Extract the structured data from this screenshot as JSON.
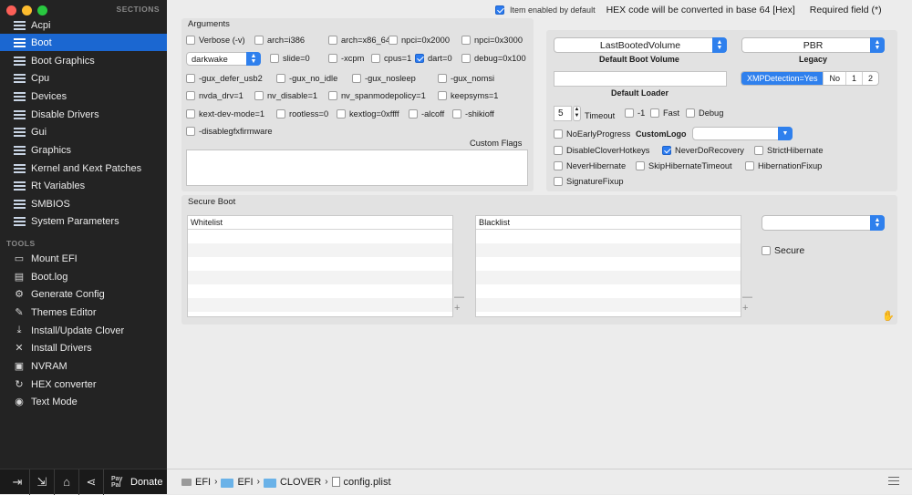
{
  "sidebar": {
    "sections_header": "SECTIONS",
    "items": [
      {
        "label": "Acpi",
        "icon": "list-icon"
      },
      {
        "label": "Boot",
        "icon": "list-icon"
      },
      {
        "label": "Boot Graphics",
        "icon": "list-icon"
      },
      {
        "label": "Cpu",
        "icon": "list-icon"
      },
      {
        "label": "Devices",
        "icon": "list-icon"
      },
      {
        "label": "Disable Drivers",
        "icon": "list-icon"
      },
      {
        "label": "Gui",
        "icon": "list-icon"
      },
      {
        "label": "Graphics",
        "icon": "list-icon"
      },
      {
        "label": "Kernel and Kext Patches",
        "icon": "list-icon"
      },
      {
        "label": "Rt Variables",
        "icon": "list-icon"
      },
      {
        "label": "SMBIOS",
        "icon": "list-icon"
      },
      {
        "label": "System Parameters",
        "icon": "list-icon"
      }
    ],
    "selected": "Boot",
    "tools_header": "TOOLS",
    "tools": [
      {
        "label": "Mount EFI",
        "icon": "drive-icon"
      },
      {
        "label": "Boot.log",
        "icon": "document-icon"
      },
      {
        "label": "Generate Config",
        "icon": "gear-icon"
      },
      {
        "label": "Themes Editor",
        "icon": "paint-icon"
      },
      {
        "label": "Install/Update Clover",
        "icon": "download-icon"
      },
      {
        "label": "Install Drivers",
        "icon": "wrench-icon"
      },
      {
        "label": "NVRAM",
        "icon": "chip-icon"
      },
      {
        "label": "HEX converter",
        "icon": "refresh-icon"
      },
      {
        "label": "Text Mode",
        "icon": "eye-icon"
      }
    ],
    "donate_label": "Donate",
    "paypal_text": "Pay Pal"
  },
  "topbar": {
    "enabled_default": "Item enabled by default",
    "hex_note": "HEX code will be converted in base 64 [Hex]",
    "required": "Required field (*)"
  },
  "arguments": {
    "title": "Arguments",
    "row1": [
      {
        "label": "Verbose (-v)",
        "checked": false
      },
      {
        "label": "arch=i386",
        "checked": false
      },
      {
        "label": "arch=x86_64",
        "checked": false
      },
      {
        "label": "npci=0x2000",
        "checked": false
      },
      {
        "label": "npci=0x3000",
        "checked": false
      }
    ],
    "darkwake_value": "darkwake",
    "row2": [
      {
        "label": "slide=0",
        "checked": false
      },
      {
        "label": "-xcpm",
        "checked": false
      },
      {
        "label": "cpus=1",
        "checked": false
      },
      {
        "label": "dart=0",
        "checked": true
      },
      {
        "label": "debug=0x100",
        "checked": false
      }
    ],
    "row3": [
      {
        "label": "-gux_defer_usb2",
        "checked": false
      },
      {
        "label": "-gux_no_idle",
        "checked": false
      },
      {
        "label": "-gux_nosleep",
        "checked": false
      },
      {
        "label": "-gux_nomsi",
        "checked": false
      }
    ],
    "row4": [
      {
        "label": "nvda_drv=1",
        "checked": false
      },
      {
        "label": "nv_disable=1",
        "checked": false
      },
      {
        "label": "nv_spanmodepolicy=1",
        "checked": false
      },
      {
        "label": "keepsyms=1",
        "checked": false
      }
    ],
    "row5": [
      {
        "label": "kext-dev-mode=1",
        "checked": false
      },
      {
        "label": "rootless=0",
        "checked": false
      },
      {
        "label": "kextlog=0xffff",
        "checked": false
      },
      {
        "label": "-alcoff",
        "checked": false
      },
      {
        "label": "-shikioff",
        "checked": false
      }
    ],
    "row6": [
      {
        "label": "-disablegfxfirmware",
        "checked": false
      }
    ],
    "custom_flags_label": "Custom Flags",
    "custom_flags_value": ""
  },
  "boot_options": {
    "default_volume_value": "LastBootedVolume",
    "default_volume_label": "Default Boot Volume",
    "legacy_value": "PBR",
    "legacy_label": "Legacy",
    "default_loader_label": "Default Loader",
    "default_loader_value": "",
    "xmp_segments": [
      "XMPDetection=Yes",
      "No",
      "1",
      "2"
    ],
    "xmp_selected": "XMPDetection=Yes",
    "timeout_value": "5",
    "timeout_label": "Timeout",
    "timeout_checks": [
      {
        "label": "-1",
        "checked": false
      },
      {
        "label": "Fast",
        "checked": false
      },
      {
        "label": "Debug",
        "checked": false
      }
    ],
    "no_early_progress": {
      "label": "NoEarlyProgress",
      "checked": false
    },
    "custom_logo_label": "CustomLogo",
    "custom_logo_value": "",
    "checks_row1": [
      {
        "label": "DisableCloverHotkeys",
        "checked": false
      },
      {
        "label": "NeverDoRecovery",
        "checked": true
      },
      {
        "label": "StrictHibernate",
        "checked": false
      }
    ],
    "checks_row2": [
      {
        "label": "NeverHibernate",
        "checked": false
      },
      {
        "label": "SkipHibernateTimeout",
        "checked": false
      },
      {
        "label": "HibernationFixup",
        "checked": false
      }
    ],
    "checks_row3": [
      {
        "label": "SignatureFixup",
        "checked": false
      }
    ]
  },
  "secure_boot": {
    "title": "Secure Boot",
    "whitelist_header": "Whitelist",
    "blacklist_header": "Blacklist",
    "policy_value": "",
    "secure_label": "Secure",
    "secure_checked": false
  },
  "pathbar": {
    "segments": [
      "EFI",
      "EFI",
      "CLOVER",
      "config.plist"
    ]
  },
  "colors": {
    "selection": "#1b67d1",
    "accent": "#2f80ed",
    "sidebar_bg": "#232323"
  }
}
